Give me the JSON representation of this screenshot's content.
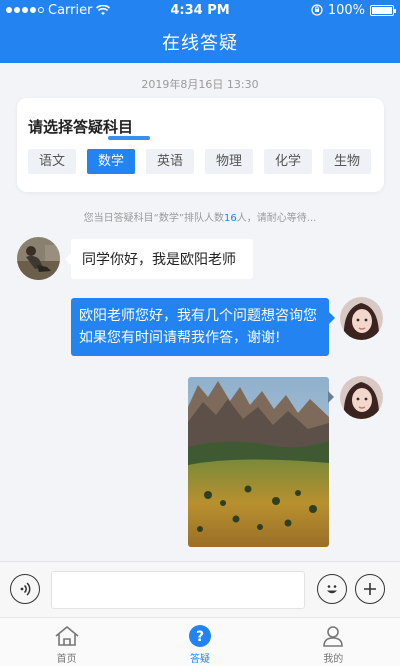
{
  "status_bar": {
    "carrier": "Carrier",
    "time": "4:34 PM",
    "battery": "100%"
  },
  "header": {
    "title": "在线答疑"
  },
  "chat": {
    "timestamp": "2019年8月16日 13:30",
    "subject_card": {
      "title": "请选择答疑科目",
      "subjects": [
        {
          "label": "语文",
          "selected": false
        },
        {
          "label": "数学",
          "selected": true
        },
        {
          "label": "英语",
          "selected": false
        },
        {
          "label": "物理",
          "selected": false
        },
        {
          "label": "化学",
          "selected": false
        },
        {
          "label": "生物",
          "selected": false
        }
      ]
    },
    "queue_note": {
      "prefix": "您当日答疑科目“数学”排队人数",
      "count": "16",
      "suffix": "人，请耐心等待..."
    },
    "messages": {
      "teacher_text": "同学你好，我是欧阳老师",
      "student_text": "欧阳老师您好，我有几个问题想咨询您如果您有时间请帮我作答，谢谢!"
    }
  },
  "input_bar": {
    "placeholder": "",
    "value": ""
  },
  "tabbar": {
    "tabs": [
      {
        "label": "首页",
        "icon": "home-icon",
        "active": false
      },
      {
        "label": "答疑",
        "icon": "question-icon",
        "active": true
      },
      {
        "label": "我的",
        "icon": "user-icon",
        "active": false
      }
    ]
  },
  "colors": {
    "accent": "#2383f0",
    "background": "#f2f4f7"
  }
}
